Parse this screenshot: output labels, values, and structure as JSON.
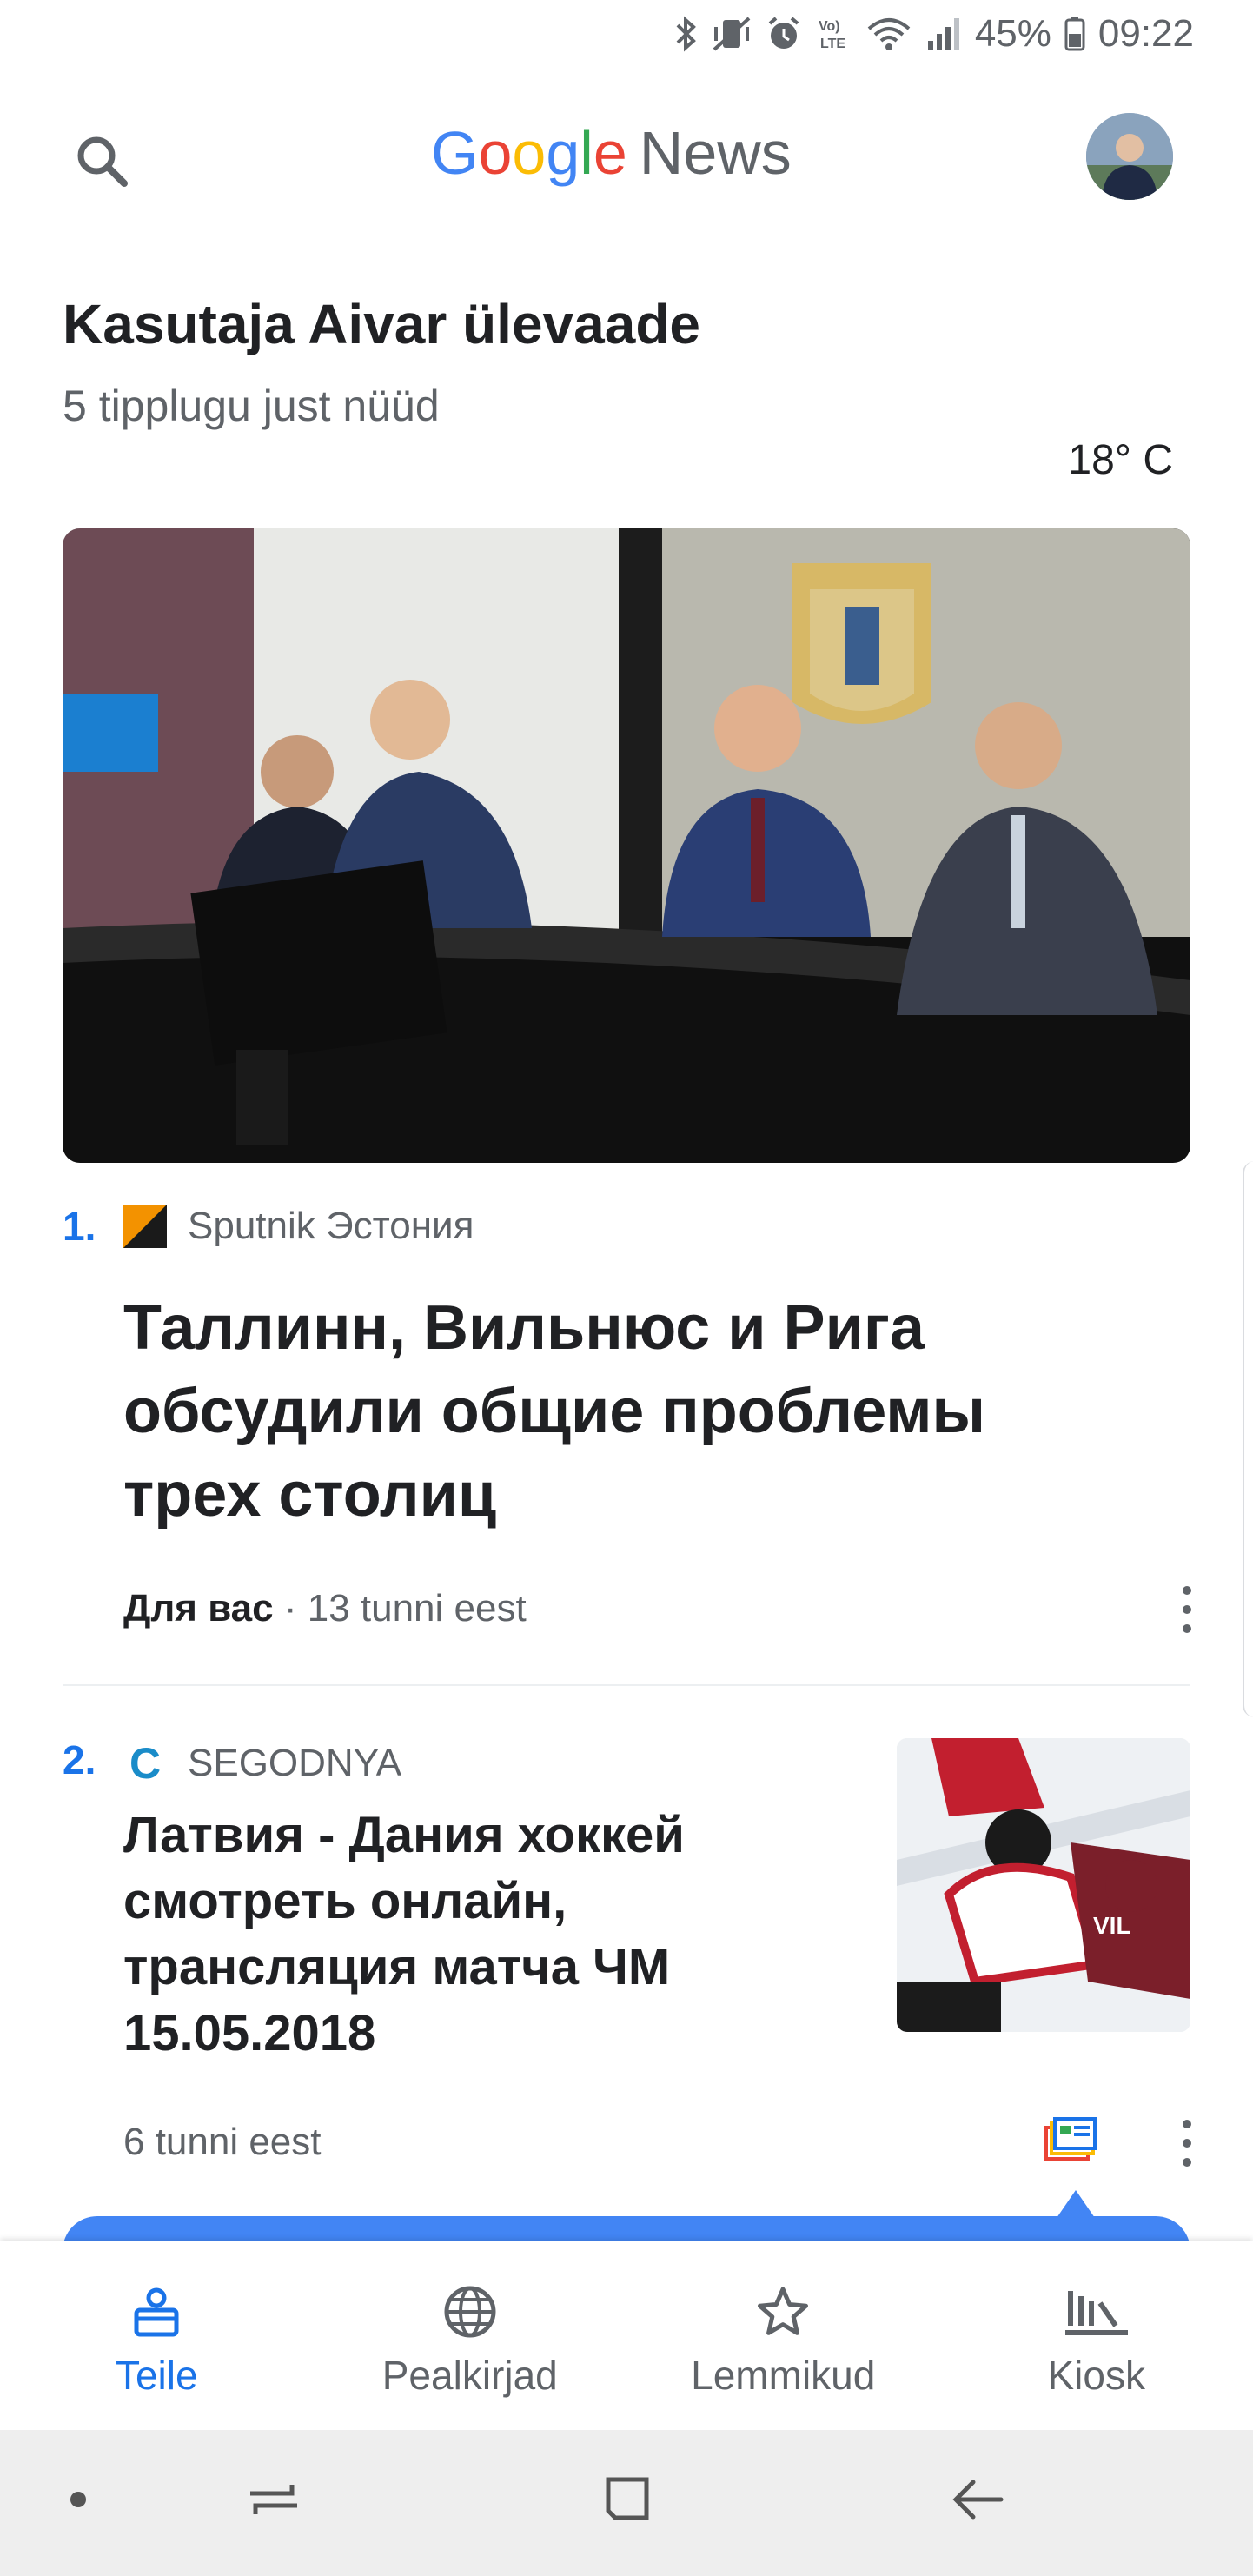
{
  "status_bar": {
    "battery": "45%",
    "time": "09:22",
    "icons": [
      "bluetooth-icon",
      "vibrate-icon",
      "alarm-icon",
      "volte-icon",
      "wifi-icon",
      "signal-icon",
      "battery-icon"
    ]
  },
  "app_bar": {
    "logo_letters": [
      "G",
      "o",
      "o",
      "g",
      "l",
      "e"
    ],
    "logo_colors": [
      "#4285f4",
      "#ea4335",
      "#fbbc05",
      "#4285f4",
      "#34a853",
      "#ea4335"
    ],
    "logo_news": "News"
  },
  "briefing": {
    "title": "Kasutaja Aivar ülevaade",
    "subtitle": "5 tipplugu just nüüd",
    "weather": "18° C"
  },
  "stories": [
    {
      "rank": "1.",
      "source": "Sputnik Эстония",
      "headline": "Таллинн, Вильнюс и Рига обсудили общие проблемы трех столиц",
      "meta_bold": "Для вас",
      "meta_sep": " · ",
      "meta_time": "13 tunni eest"
    },
    {
      "rank": "2.",
      "source": "SEGODNYA",
      "source_logo_letter": "C",
      "headline": "Латвия - Дания хоккей смотреть онлайн, трансляция матча ЧМ 15.05.2018",
      "meta_time": "6 tunni eest"
    }
  ],
  "bottom_nav": {
    "items": [
      {
        "label": "Teile",
        "icon": "for-you-icon",
        "active": true
      },
      {
        "label": "Pealkirjad",
        "icon": "globe-icon",
        "active": false
      },
      {
        "label": "Lemmikud",
        "icon": "star-icon",
        "active": false
      },
      {
        "label": "Kiosk",
        "icon": "newsstand-icon",
        "active": false
      }
    ]
  },
  "colors": {
    "accent": "#1a73e8",
    "text_primary": "#202124",
    "text_secondary": "#5f6368"
  }
}
